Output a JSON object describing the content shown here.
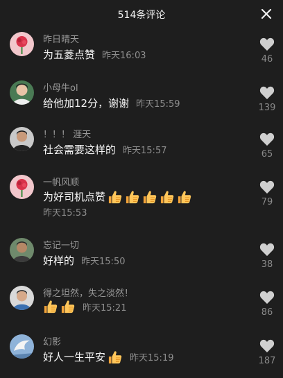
{
  "header": {
    "title": "514条评论",
    "close_icon": "close-icon"
  },
  "comments": [
    {
      "username": "昨日晴天",
      "text": "为五菱点赞",
      "time": "昨天16:03",
      "likes": "46",
      "avatar_icon": "rose-avatar-icon"
    },
    {
      "username": "小母牛ol",
      "text": "给他加12分，谢谢",
      "time": "昨天15:59",
      "likes": "139",
      "avatar_icon": "person-avatar-icon"
    },
    {
      "username": "！！！ 涯天",
      "text": "社会需要这样的",
      "time": "昨天15:57",
      "likes": "65",
      "avatar_icon": "person-avatar-icon"
    },
    {
      "username": "一帆风顺",
      "text": "为好司机点赞",
      "thumbs_count": 5,
      "time": "昨天15:53",
      "likes": "79",
      "avatar_icon": "rose-avatar-icon"
    },
    {
      "username": "忘记一切",
      "text": "好样的",
      "time": "昨天15:50",
      "likes": "38",
      "avatar_icon": "person-avatar-icon"
    },
    {
      "username": "得之坦然，失之淡然！",
      "thumbs_count": 2,
      "time": "昨天15:21",
      "likes": "86",
      "avatar_icon": "person-avatar-icon"
    },
    {
      "username": "幻影",
      "text": "好人一生平安",
      "thumbs_count": 1,
      "time": "昨天15:19",
      "likes": "187",
      "avatar_icon": "bird-avatar-icon"
    }
  ],
  "colors": {
    "background": "#1e1e1e",
    "username": "#9a9a9a",
    "heart": "#cfcfcf"
  }
}
